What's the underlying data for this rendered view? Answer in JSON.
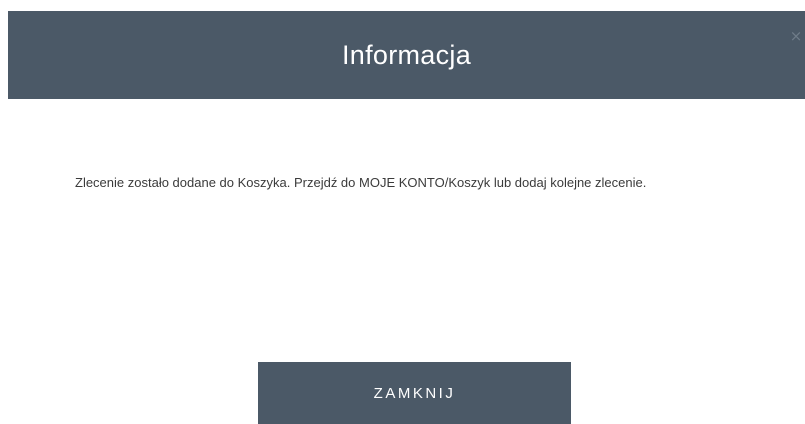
{
  "dialog": {
    "title": "Informacja",
    "close_icon_glyph": "×",
    "message": "Zlecenie zostało dodane do Koszyka. Przejdź do MOJE KONTO/Koszyk lub dodaj kolejne zlecenie.",
    "close_button_label": "ZAMKNIJ"
  },
  "colors": {
    "header_background": "#4b5967",
    "button_background": "#4b5967",
    "text": "#3b3b3b"
  }
}
